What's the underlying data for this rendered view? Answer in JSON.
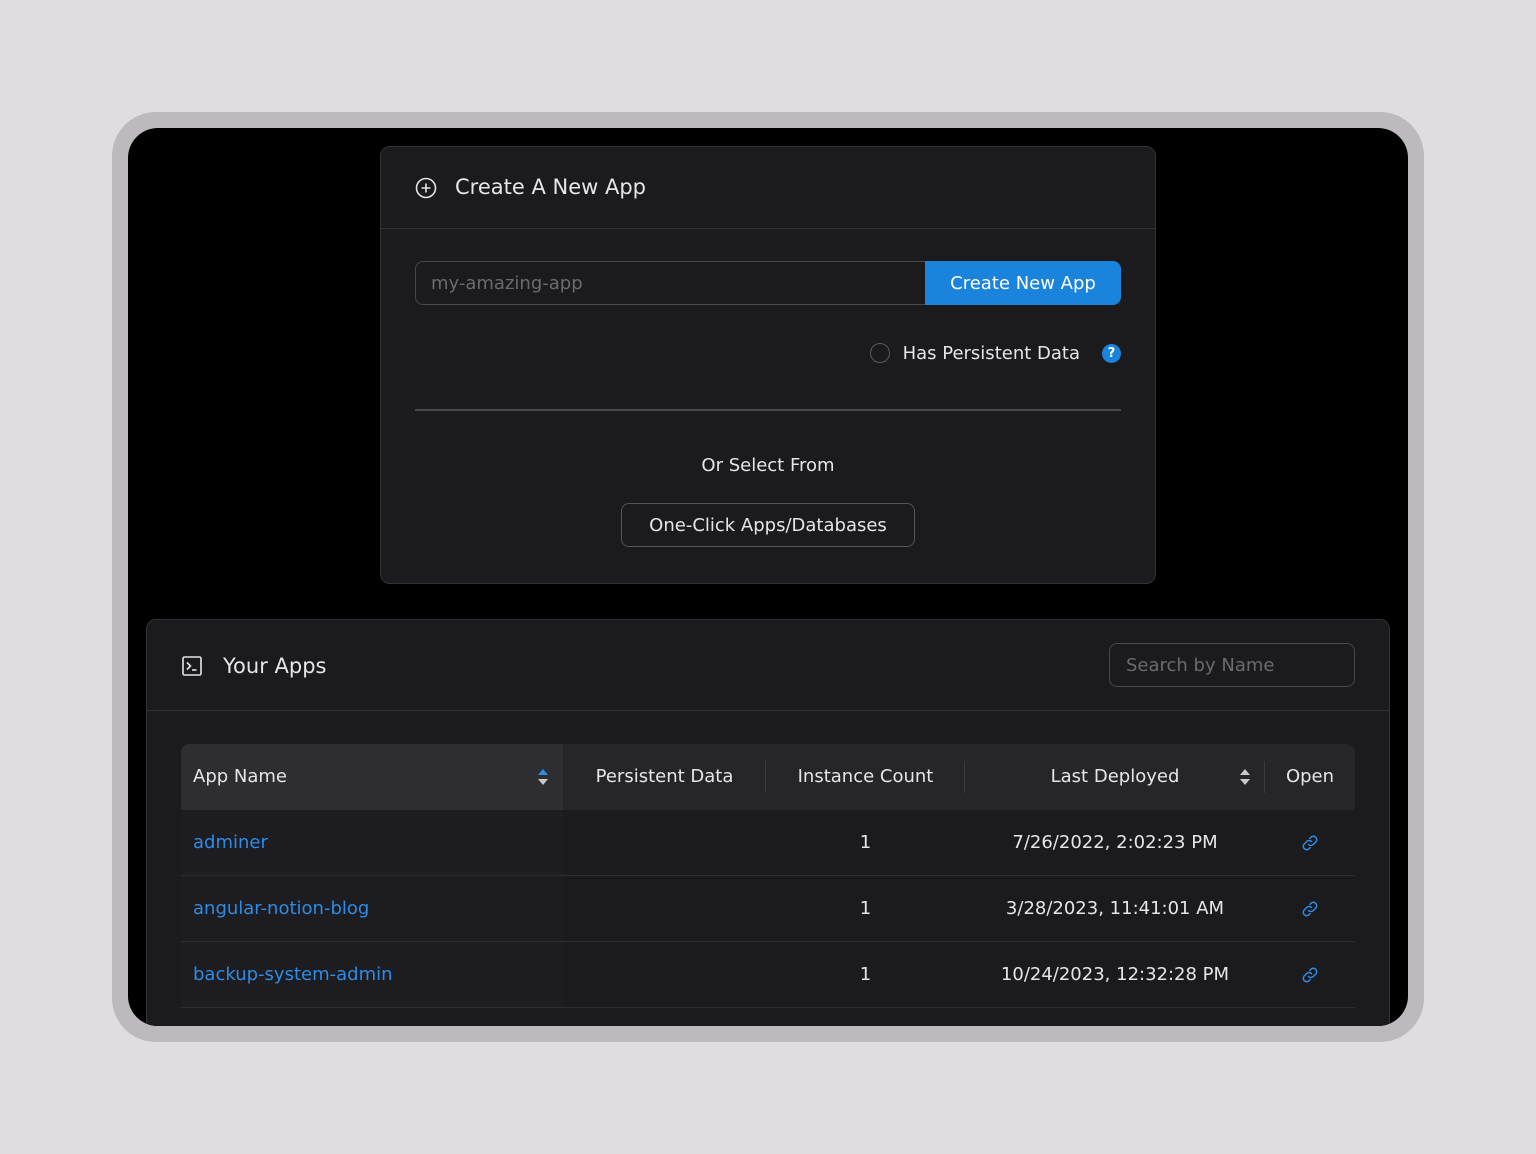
{
  "create_card": {
    "title": "Create A New App",
    "title_icon": "plus-circle-icon",
    "app_name_placeholder": "my-amazing-app",
    "app_name_value": "",
    "create_button_label": "Create New App",
    "persistent_label": "Has Persistent Data",
    "persistent_checked": false,
    "help_icon": "question-circle-icon",
    "help_glyph": "?",
    "or_select_label": "Or Select From",
    "one_click_button_label": "One-Click Apps/Databases"
  },
  "apps_card": {
    "title": "Your Apps",
    "title_icon": "terminal-icon",
    "search_placeholder": "Search by Name",
    "search_value": "",
    "columns": {
      "app_name": "App Name",
      "persistent_data": "Persistent Data",
      "instance_count": "Instance Count",
      "last_deployed": "Last Deployed",
      "open": "Open"
    },
    "rows": [
      {
        "app_name": "adminer",
        "persistent_data": "",
        "instance_count": "1",
        "last_deployed": "7/26/2022, 2:02:23 PM",
        "open_icon": "link-icon"
      },
      {
        "app_name": "angular-notion-blog",
        "persistent_data": "",
        "instance_count": "1",
        "last_deployed": "3/28/2023, 11:41:01 AM",
        "open_icon": "link-icon"
      },
      {
        "app_name": "backup-system-admin",
        "persistent_data": "",
        "instance_count": "1",
        "last_deployed": "10/24/2023, 12:32:28 PM",
        "open_icon": "link-icon"
      }
    ]
  },
  "colors": {
    "accent": "#1a84dc",
    "link": "#2c8ce6",
    "card_bg": "#1b1a1d",
    "screen_bg": "#000000",
    "page_bg": "#dfdde0"
  }
}
